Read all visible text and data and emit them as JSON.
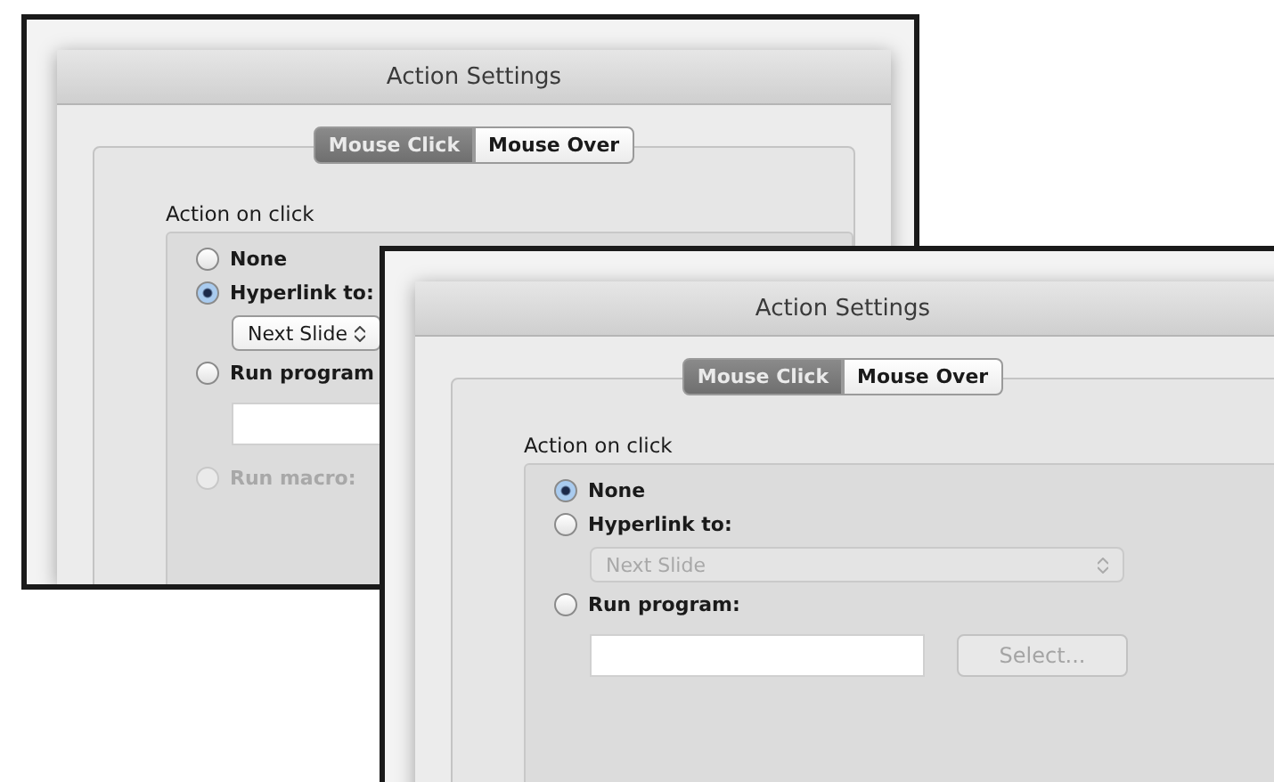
{
  "windows": [
    {
      "title": "Action Settings",
      "tabs": [
        {
          "label": "Mouse Click",
          "selected": true
        },
        {
          "label": "Mouse Over",
          "selected": false
        }
      ],
      "group_title": "Action on click",
      "options": [
        {
          "kind": "radio",
          "label": "None",
          "selected": false,
          "disabled": false
        },
        {
          "kind": "radio",
          "label": "Hyperlink to:",
          "selected": true,
          "disabled": false
        },
        {
          "kind": "popup",
          "value": "Next Slide",
          "disabled": false
        },
        {
          "kind": "radio",
          "label": "Run program",
          "selected": false,
          "disabled": false
        },
        {
          "kind": "field"
        },
        {
          "kind": "radio",
          "label": "Run macro:",
          "selected": false,
          "disabled": true
        }
      ]
    },
    {
      "title": "Action Settings",
      "tabs": [
        {
          "label": "Mouse Click",
          "selected": true
        },
        {
          "label": "Mouse Over",
          "selected": false
        }
      ],
      "group_title": "Action on click",
      "options": [
        {
          "kind": "radio",
          "label": "None",
          "selected": true,
          "disabled": false
        },
        {
          "kind": "radio",
          "label": "Hyperlink to:",
          "selected": false,
          "disabled": false
        },
        {
          "kind": "popup",
          "value": "Next Slide",
          "disabled": true
        },
        {
          "kind": "radio",
          "label": "Run program:",
          "selected": false,
          "disabled": false
        },
        {
          "kind": "field",
          "button": "Select...",
          "button_disabled": true
        }
      ]
    }
  ]
}
